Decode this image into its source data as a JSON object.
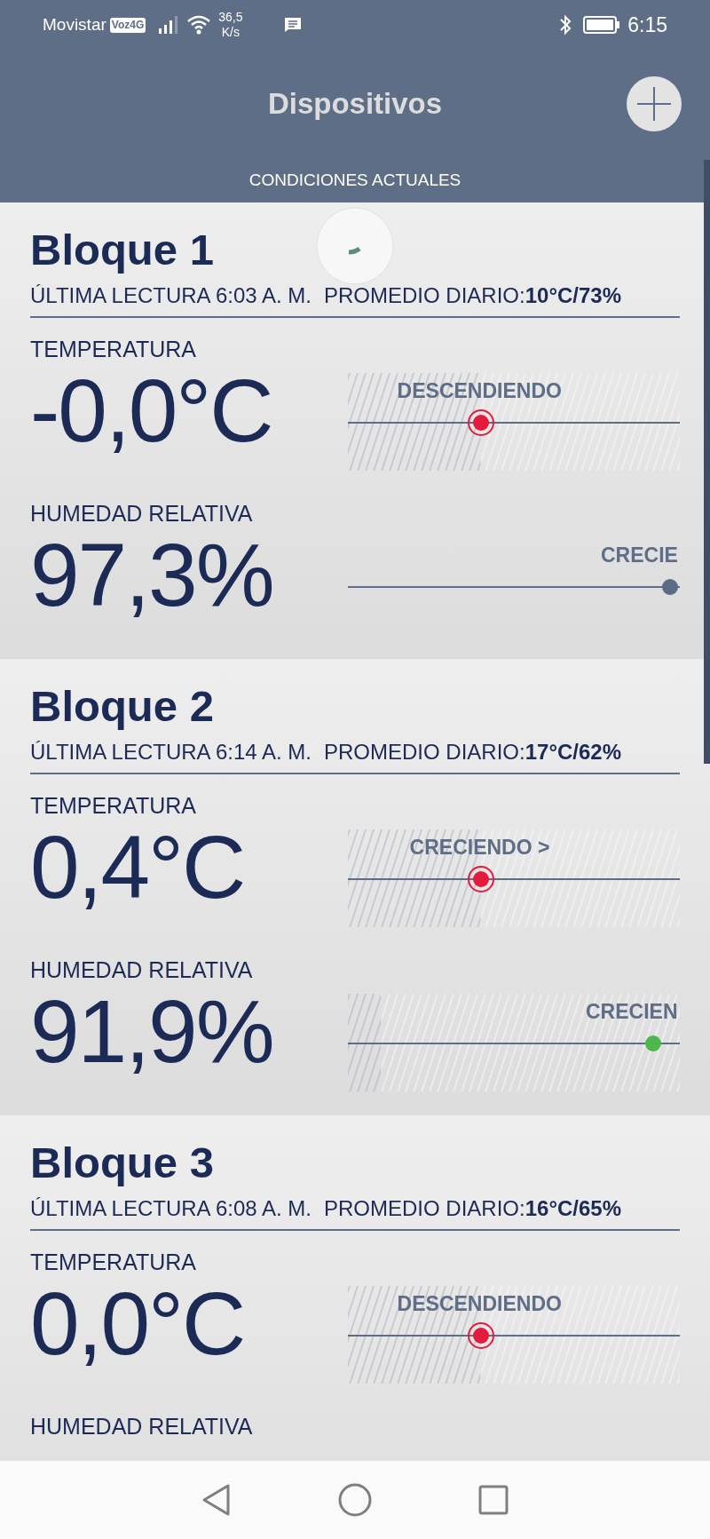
{
  "status_bar": {
    "carrier": "Movistar",
    "network_badge": "Voz4G",
    "speed": "36,5",
    "speed_unit": "K/s",
    "time": "6:15"
  },
  "header": {
    "title": "Dispositivos",
    "subtitle": "CONDICIONES ACTUALES"
  },
  "blocks": [
    {
      "name": "Bloque 1",
      "last_reading": "ÚLTIMA LECTURA 6:03 A. M.",
      "daily_average": "PROMEDIO DIARIO:**10°C/73%**",
      "metrics": [
        {
          "label": "TEMPERATURA",
          "value": "-0,0°C",
          "trend": {
            "label": "DESCENDIENDO",
            "level": 0.4,
            "kind": "target",
            "color": "#e31b3c",
            "hatch": {
              "level": 0.4
            }
          }
        },
        {
          "label": "HUMEDAD RELATIVA",
          "value": "97,3%",
          "trend": {
            "label": "CRECIE",
            "level": 0.97,
            "kind": "dot",
            "color": "#5a6b85"
          }
        }
      ]
    },
    {
      "name": "Bloque 2",
      "last_reading": "ÚLTIMA LECTURA 6:14 A. M.",
      "daily_average": "PROMEDIO DIARIO:**17°C/62%**",
      "metrics": [
        {
          "label": "TEMPERATURA",
          "value": "0,4°C",
          "trend": {
            "label": "CRECIENDO >",
            "level": 0.4,
            "kind": "target",
            "color": "#e31b3c",
            "hatch": {
              "level": 0.4
            }
          }
        },
        {
          "label": "HUMEDAD RELATIVA",
          "value": "91,9%",
          "trend": {
            "label": "CRECIEN",
            "level": 0.92,
            "kind": "dot",
            "color": "#4cb84c",
            "hatch": {
              "level": 0.1
            }
          }
        }
      ]
    },
    {
      "name": "Bloque 3",
      "last_reading": "ÚLTIMA LECTURA 6:08 A. M.",
      "daily_average": "PROMEDIO DIARIO:**16°C/65%**",
      "metrics": [
        {
          "label": "TEMPERATURA",
          "value": "0,0°C",
          "trend": {
            "label": "DESCENDIENDO",
            "level": 0.4,
            "kind": "target",
            "color": "#e31b3c",
            "hatch": {
              "level": 0.4
            }
          }
        },
        {
          "label": "HUMEDAD RELATIVA"
        }
      ]
    }
  ]
}
